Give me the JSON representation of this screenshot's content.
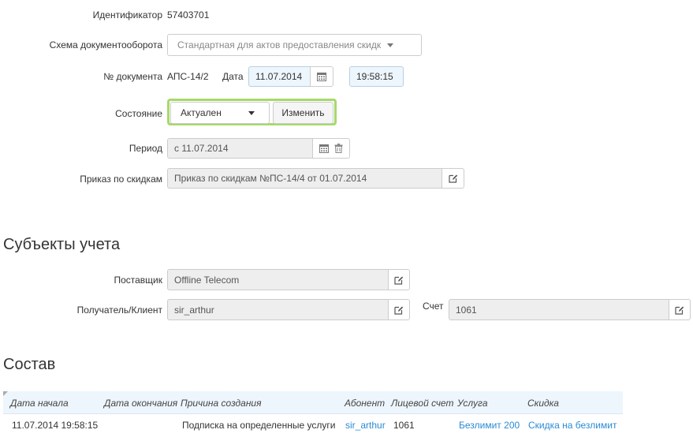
{
  "identifier": {
    "label": "Идентификатор",
    "value": "57403701"
  },
  "workflow": {
    "label": "Схема документооборота",
    "value": "Стандартная для актов предоставления скидк"
  },
  "doc_number": {
    "label": "№ документа",
    "value": "АПС-14/2",
    "date_label": "Дата",
    "date_value": "11.07.2014",
    "time_value": "19:58:15"
  },
  "state": {
    "label": "Состояние",
    "value": "Актуален",
    "change_button": "Изменить"
  },
  "period": {
    "label": "Период",
    "value": "с 11.07.2014"
  },
  "discount_order": {
    "label": "Приказ по скидкам",
    "value": "Приказ по скидкам №ПС-14/4 от 01.07.2014"
  },
  "subjects": {
    "heading": "Субъекты учета",
    "supplier_label": "Поставщик",
    "supplier_value": "Offline Telecom",
    "client_label": "Получатель/Клиент",
    "client_value": "sir_arthur",
    "account_label": "Счет",
    "account_value": "1061"
  },
  "composition": {
    "heading": "Состав",
    "columns": [
      "Дата начала",
      "Дата окончания",
      "Причина создания",
      "Абонент",
      "Лицевой счет",
      "Услуга",
      "Скидка"
    ],
    "rows": [
      [
        "11.07.2014 19:58:15",
        "",
        "Подписка на определенные услуги",
        "sir_arthur",
        "1061",
        "Безлимит 200",
        "Скидка на безлимит"
      ]
    ]
  },
  "colors": {
    "link": "#2a8bd5",
    "state_highlight": "#a6d96a",
    "table_header_bg": "#edf6fd"
  }
}
